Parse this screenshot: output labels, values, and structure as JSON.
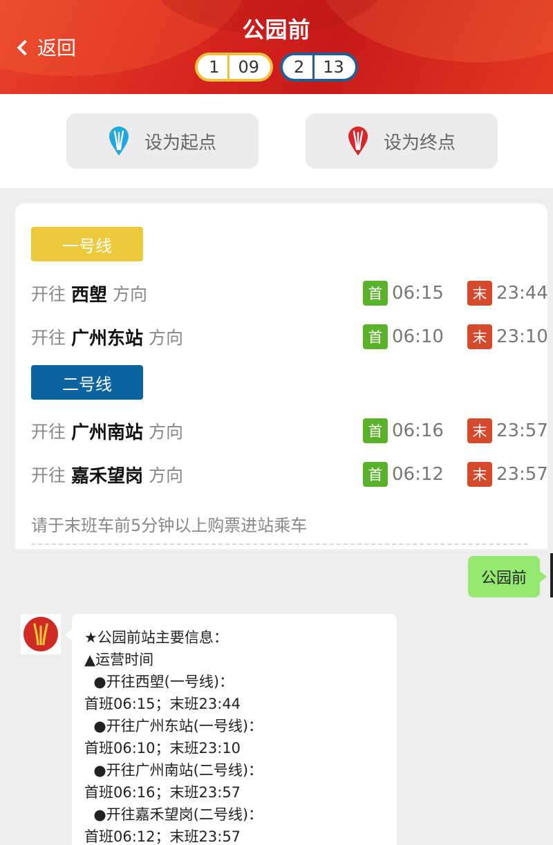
{
  "header": {
    "back_label": "返回",
    "title": "公园前",
    "badges": [
      {
        "line": "1",
        "code": "09",
        "color": "#e9c33b"
      },
      {
        "line": "2",
        "code": "13",
        "color": "#1f5f94"
      }
    ]
  },
  "actions": {
    "start_label": "设为起点",
    "end_label": "设为终点"
  },
  "lines": [
    {
      "name": "一号线",
      "color": "#edca3c",
      "directions": [
        {
          "prefix": "开往",
          "dest": "西塱",
          "suffix": "方向",
          "first_tag": "首",
          "first": "06:15",
          "last_tag": "末",
          "last": "23:44"
        },
        {
          "prefix": "开往",
          "dest": "广州东站",
          "suffix": "方向",
          "first_tag": "首",
          "first": "06:10",
          "last_tag": "末",
          "last": "23:10"
        }
      ]
    },
    {
      "name": "二号线",
      "color": "#0b64a0",
      "directions": [
        {
          "prefix": "开往",
          "dest": "广州南站",
          "suffix": "方向",
          "first_tag": "首",
          "first": "06:16",
          "last_tag": "末",
          "last": "23:57"
        },
        {
          "prefix": "开往",
          "dest": "嘉禾望岗",
          "suffix": "方向",
          "first_tag": "首",
          "first": "06:12",
          "last_tag": "末",
          "last": "23:57"
        }
      ]
    }
  ],
  "note": "请于末班车前5分钟以上购票进站乘车",
  "chat": {
    "user_message": "公园前",
    "bot_lines": [
      "★公园前站主要信息：",
      "▲运营时间",
      "  ●开往西塱(一号线)：",
      "首班06:15；末班23:44",
      "  ●开往广州东站(一号线)：",
      "首班06:10；末班23:10",
      "  ●开往广州南站(二号线)：",
      "首班06:16；末班23:57",
      "  ●开往嘉禾望岗(二号线)：",
      "首班06:12；末班23:57"
    ]
  },
  "colors": {
    "header_red": "#d9271f",
    "first_green": "#5ab22a",
    "last_red": "#d54a2d",
    "user_bubble": "#94e86f"
  },
  "icons": {
    "start_pin": "metro-pin-blue-icon",
    "end_pin": "metro-pin-red-icon",
    "avatar": "metro-logo-icon"
  }
}
